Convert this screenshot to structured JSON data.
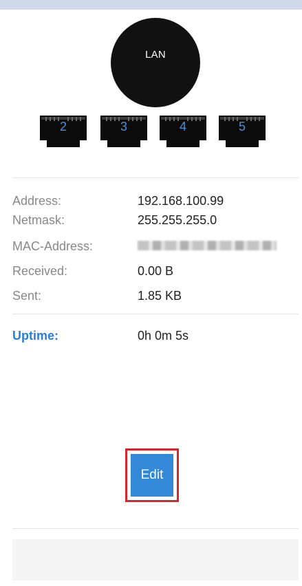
{
  "lan": {
    "label": "LAN"
  },
  "ports": [
    "2",
    "3",
    "4",
    "5"
  ],
  "info": {
    "address": {
      "label": "Address:",
      "value": "192.168.100.99"
    },
    "netmask": {
      "label": "Netmask:",
      "value": "255.255.255.0"
    },
    "mac": {
      "label": "MAC-Address:"
    },
    "received": {
      "label": "Received:",
      "value": "0.00 B"
    },
    "sent": {
      "label": "Sent:",
      "value": "1.85 KB"
    }
  },
  "uptime": {
    "label": "Uptime:",
    "value": "0h 0m 5s"
  },
  "actions": {
    "edit_label": "Edit"
  },
  "colors": {
    "accent": "#3388d8",
    "highlight": "#d9262c",
    "uptime": "#2b7fd1"
  }
}
